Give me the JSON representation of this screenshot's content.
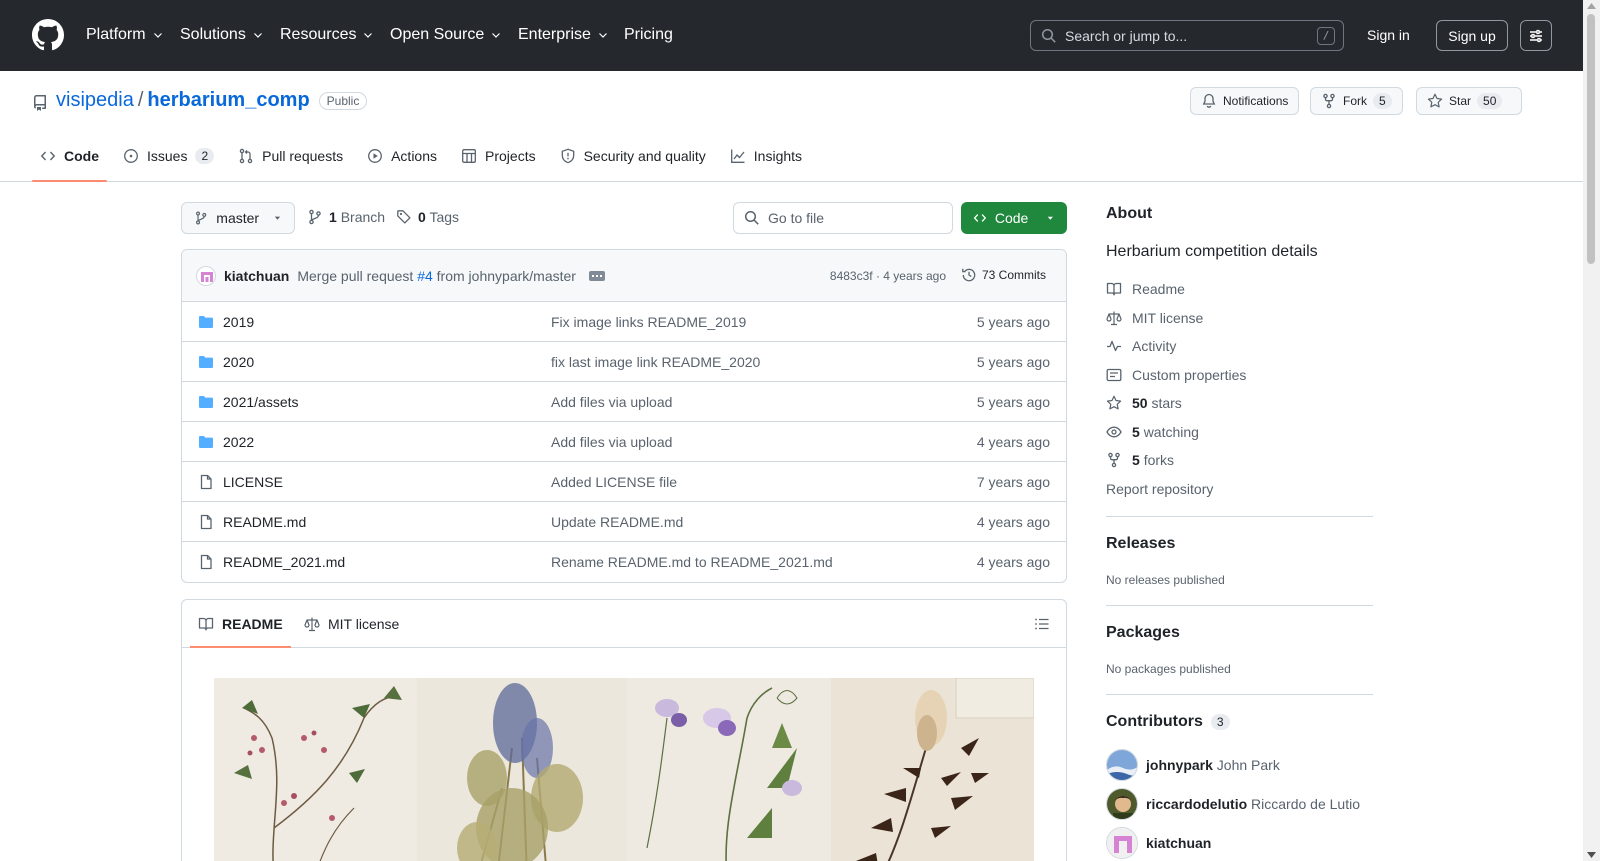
{
  "header": {
    "nav": [
      {
        "label": "Platform",
        "chevron": true
      },
      {
        "label": "Solutions",
        "chevron": true
      },
      {
        "label": "Resources",
        "chevron": true
      },
      {
        "label": "Open Source",
        "chevron": true
      },
      {
        "label": "Enterprise",
        "chevron": true
      },
      {
        "label": "Pricing",
        "chevron": false
      }
    ],
    "search_placeholder": "Search or jump to...",
    "search_shortcut": "/",
    "signin": "Sign in",
    "signup": "Sign up"
  },
  "repo": {
    "owner": "visipedia",
    "separator": "/",
    "name": "herbarium_comp",
    "visibility": "Public",
    "notifications": "Notifications",
    "fork_label": "Fork",
    "fork_count": "5",
    "star_label": "Star",
    "star_count": "50"
  },
  "tabs": [
    {
      "label": "Code",
      "icon": "code-icon",
      "active": true
    },
    {
      "label": "Issues",
      "icon": "issue-icon",
      "count": "2"
    },
    {
      "label": "Pull requests",
      "icon": "pull-request-icon"
    },
    {
      "label": "Actions",
      "icon": "actions-icon"
    },
    {
      "label": "Projects",
      "icon": "projects-icon"
    },
    {
      "label": "Security and quality",
      "icon": "shield-icon"
    },
    {
      "label": "Insights",
      "icon": "graph-icon"
    }
  ],
  "toolbar": {
    "branch": "master",
    "branches_count": "1",
    "branches_label": "Branch",
    "tags_count": "0",
    "tags_label": "Tags",
    "goto_placeholder": "Go to file",
    "code_label": "Code"
  },
  "latest_commit": {
    "author": "kiatchuan",
    "message_pre": "Merge pull request",
    "pr": "#4",
    "message_post": "from johnypark/master",
    "sha": "8483c3f",
    "sep": "·",
    "age": "4 years ago",
    "commits_label": "73 Commits"
  },
  "files": [
    {
      "name": "2019",
      "type": "folder",
      "commit": "Fix image links README_2019",
      "date": "5 years ago"
    },
    {
      "name": "2020",
      "type": "folder",
      "commit": "fix last image link README_2020",
      "date": "5 years ago"
    },
    {
      "name": "2021/assets",
      "type": "folder",
      "commit": "Add files via upload",
      "date": "5 years ago"
    },
    {
      "name": "2022",
      "type": "folder",
      "commit": "Add files via upload",
      "date": "4 years ago"
    },
    {
      "name": "LICENSE",
      "type": "file",
      "commit": "Added LICENSE file",
      "date": "7 years ago"
    },
    {
      "name": "README.md",
      "type": "file",
      "commit": "Update README.md",
      "date": "4 years ago"
    },
    {
      "name": "README_2021.md",
      "type": "file",
      "commit": "Rename README.md to README_2021.md",
      "date": "4 years ago"
    }
  ],
  "readme": {
    "tab_readme": "README",
    "tab_license": "MIT license"
  },
  "about": {
    "title": "About",
    "description": "Herbarium competition details",
    "links": [
      {
        "label": "Readme",
        "icon": "book-icon"
      },
      {
        "label": "MIT license",
        "icon": "law-icon"
      },
      {
        "label": "Activity",
        "icon": "pulse-icon"
      },
      {
        "label": "Custom properties",
        "icon": "note-icon"
      }
    ],
    "stars_count": "50",
    "stars_label": "stars",
    "watching_count": "5",
    "watching_label": "watching",
    "forks_count": "5",
    "forks_label": "forks",
    "report": "Report repository"
  },
  "releases": {
    "title": "Releases",
    "note": "No releases published"
  },
  "packages": {
    "title": "Packages",
    "note": "No packages published"
  },
  "contributors": {
    "title": "Contributors",
    "count": "3",
    "people": [
      {
        "login": "johnypark",
        "name": "John Park"
      },
      {
        "login": "riccardodelutio",
        "name": "Riccardo de Lutio"
      },
      {
        "login": "kiatchuan",
        "name": ""
      }
    ]
  },
  "colors": {
    "header_bg": "#25292e",
    "link": "#0969da",
    "primary_button": "#1f883d",
    "tab_underline": "#fd8c73",
    "folder": "#54aeff"
  }
}
